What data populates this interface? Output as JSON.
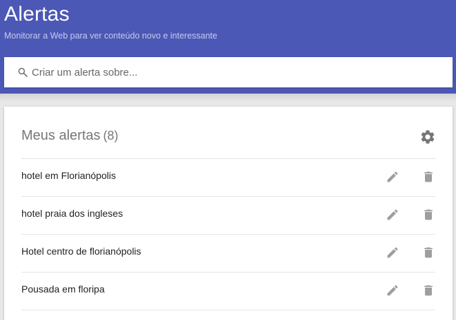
{
  "header": {
    "title": "Alertas",
    "subtitle": "Monitorar a Web para ver conteúdo novo e interessante",
    "background_color": "#4c58b5"
  },
  "search": {
    "placeholder": "Criar um alerta sobre...",
    "value": "",
    "icon": "search-icon"
  },
  "alerts_card": {
    "title": "Meus alertas",
    "count": "(8)",
    "settings_icon": "gear-icon",
    "items": [
      {
        "label": "hotel em Florianópolis",
        "edit_icon": "pencil-icon",
        "delete_icon": "trash-icon"
      },
      {
        "label": "hotel praia dos ingleses",
        "edit_icon": "pencil-icon",
        "delete_icon": "trash-icon"
      },
      {
        "label": "Hotel centro de florianópolis",
        "edit_icon": "pencil-icon",
        "delete_icon": "trash-icon"
      },
      {
        "label": "Pousada em floripa",
        "edit_icon": "pencil-icon",
        "delete_icon": "trash-icon"
      }
    ]
  }
}
